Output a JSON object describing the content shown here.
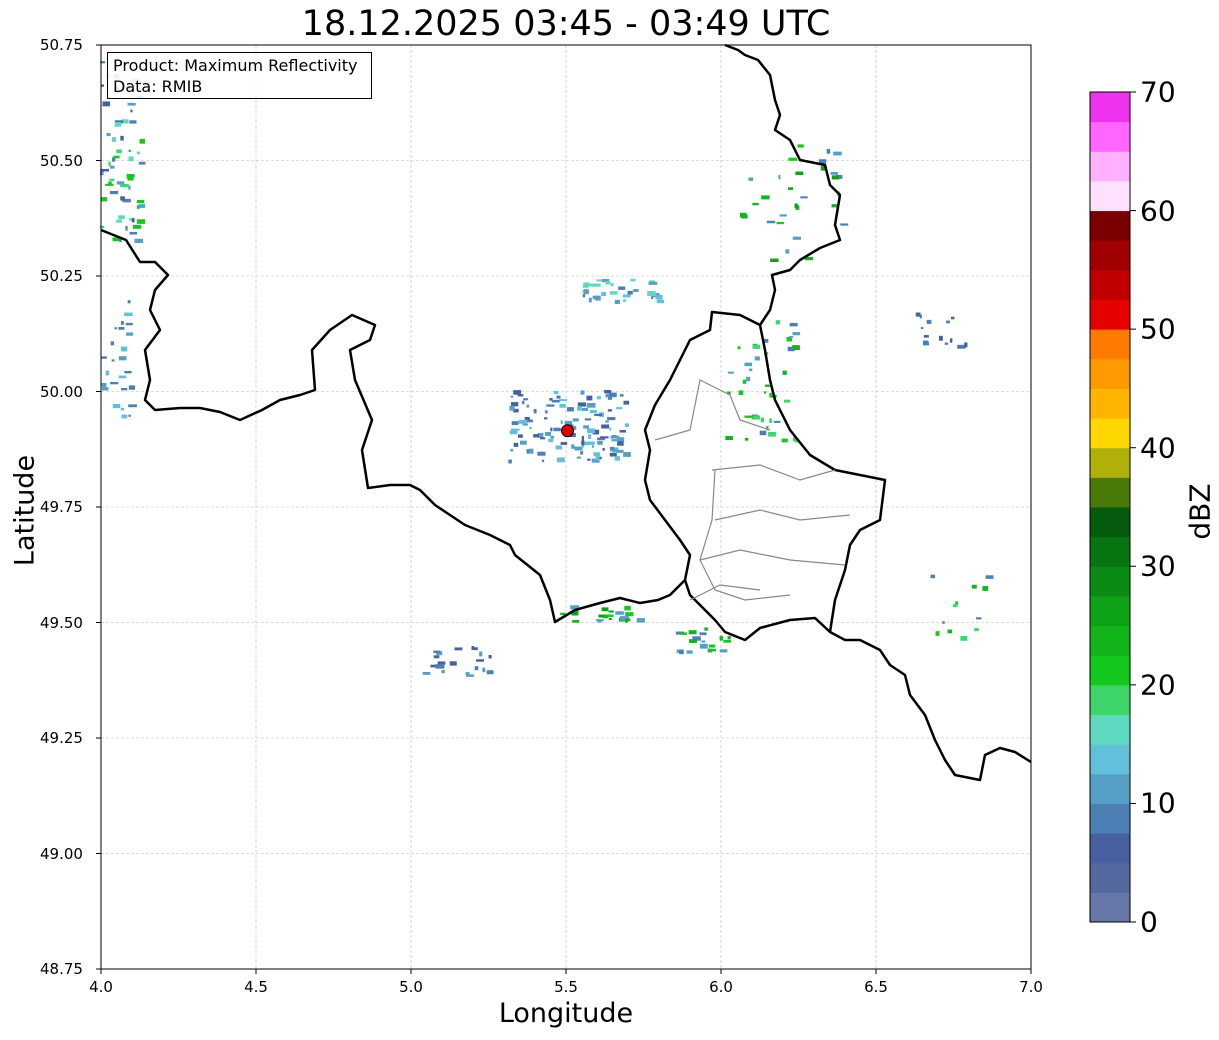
{
  "title": "18.12.2025 03:45 - 03:49 UTC",
  "info_box": {
    "product": "Product: Maximum Reflectivity",
    "data": "Data: RMIB"
  },
  "axes": {
    "xlabel": "Longitude",
    "ylabel": "Latitude",
    "xlim": [
      4.0,
      7.0
    ],
    "ylim": [
      48.75,
      50.75
    ],
    "xticks": [
      "4.0",
      "4.5",
      "5.0",
      "5.5",
      "6.0",
      "6.5",
      "7.0"
    ],
    "yticks": [
      "48.75",
      "49.00",
      "49.25",
      "49.50",
      "49.75",
      "50.00",
      "50.25",
      "50.50",
      "50.75"
    ],
    "grid": true
  },
  "radar_site": {
    "lon": 5.505,
    "lat": 49.915,
    "color": "#e00000"
  },
  "colorbar": {
    "label": "dBZ",
    "range": [
      0,
      70
    ],
    "step": 2.5,
    "ticks": [
      "0",
      "10",
      "20",
      "30",
      "40",
      "50",
      "60",
      "70"
    ],
    "colors": [
      "#6677a8",
      "#5468a0",
      "#4660a0",
      "#4c7fb4",
      "#56a0c8",
      "#62c0da",
      "#5fd8c0",
      "#3ed66a",
      "#14c81e",
      "#12b41a",
      "#0ea316",
      "#0a8c14",
      "#087412",
      "#065c0e",
      "#4a7a0a",
      "#b0b00a",
      "#ffd700",
      "#ffb400",
      "#ff9a00",
      "#ff7a00",
      "#e60000",
      "#c00000",
      "#a00000",
      "#7a0000",
      "#ffe0ff",
      "#ffb0ff",
      "#ff66ff",
      "#ee33ee"
    ]
  }
}
